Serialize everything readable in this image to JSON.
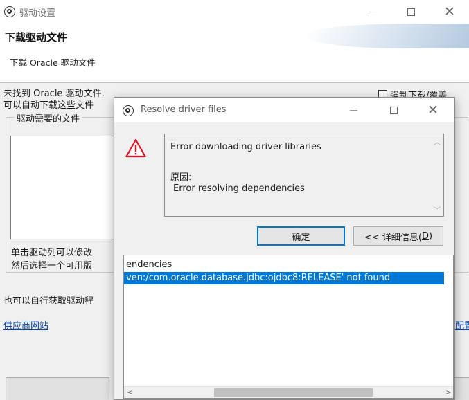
{
  "main_window": {
    "title": "驱动设置",
    "heading": "下载驱动文件",
    "subheading": "下载 Oracle 驱动文件",
    "not_found_text": "未找到 Oracle 驱动文件.",
    "auto_download_text": "可以自动下载这些文件",
    "force_download_label": "强制下载/覆盖",
    "group_title": "驱动需要的文件",
    "hint_line1": "单击驱动列可以修改",
    "hint_line2": "然后选择一个可用版",
    "manual_text": "也可以自行获取驱动程",
    "vendor_link": "供应商网站",
    "right_link_fragment": "配置"
  },
  "dialog": {
    "title": "Resolve driver files",
    "message_title": "Error downloading driver libraries",
    "reason_label": "原因:",
    "reason_detail": "Error resolving dependencies",
    "ok_label": "确定",
    "details_label_prefix": "<< 详细信息(",
    "details_mnemonic": "D",
    "details_label_suffix": ")",
    "details_lines": [
      "endencies",
      "ven:/com.oracle.database.jdbc:ojdbc8:RELEASE' not found"
    ]
  },
  "icons": {
    "app": "app-icon",
    "warning": "warning-icon",
    "warning_color": "#e81123"
  },
  "colors": {
    "accent": "#0078d7",
    "link": "#0645ad"
  }
}
